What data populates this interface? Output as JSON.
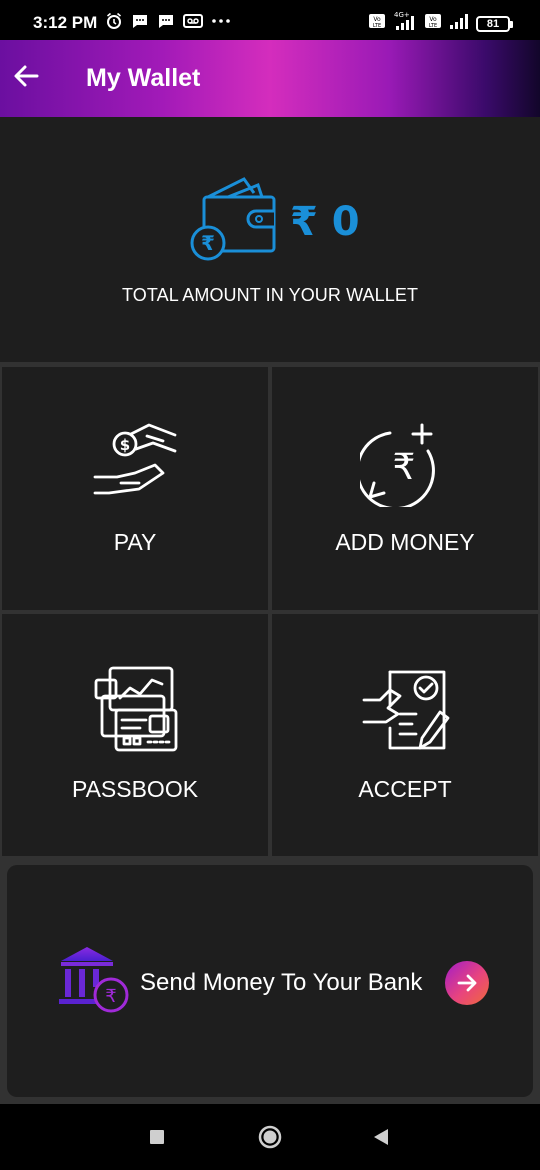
{
  "status_bar": {
    "time": "3:12 PM",
    "battery": "81",
    "network_label": "4G+",
    "sim_label": "Vo LTE",
    "left_icons": [
      "alarm-icon",
      "message-icon",
      "message-icon",
      "voicemail-icon",
      "more-dots-icon"
    ],
    "right_icons": [
      "volte-icon",
      "signal-icon",
      "volte-icon",
      "signal-icon",
      "battery-icon"
    ]
  },
  "app_bar": {
    "title": "My Wallet",
    "back_icon": "back-arrow-icon",
    "gradient": [
      "#6b0fa0",
      "#d42dbd",
      "#12062a"
    ]
  },
  "balance": {
    "amount": "₹ 0",
    "label": "TOTAL AMOUNT IN YOUR WALLET",
    "icon": "wallet-rupee-icon",
    "accent_color": "#1a8fd8"
  },
  "actions": [
    {
      "label": "PAY",
      "icon": "pay-hands-icon"
    },
    {
      "label": "ADD MONEY",
      "icon": "add-money-icon"
    },
    {
      "label": "PASSBOOK",
      "icon": "passbook-cards-icon"
    },
    {
      "label": "ACCEPT",
      "icon": "accept-document-icon"
    }
  ],
  "bank_transfer": {
    "label": "Send Money To Your Bank",
    "icon": "bank-rupee-icon",
    "arrow_icon": "arrow-right-icon"
  },
  "nav_bar": {
    "buttons": [
      "recents-square-icon",
      "home-circle-icon",
      "back-triangle-icon"
    ]
  },
  "colors": {
    "background": "#323232",
    "card": "#1e1e1e",
    "accent_blue": "#1a8fd8",
    "bank_purple": "#7a2bd9",
    "arrow_gradient": [
      "#a21cc9",
      "#f06a3a"
    ]
  }
}
